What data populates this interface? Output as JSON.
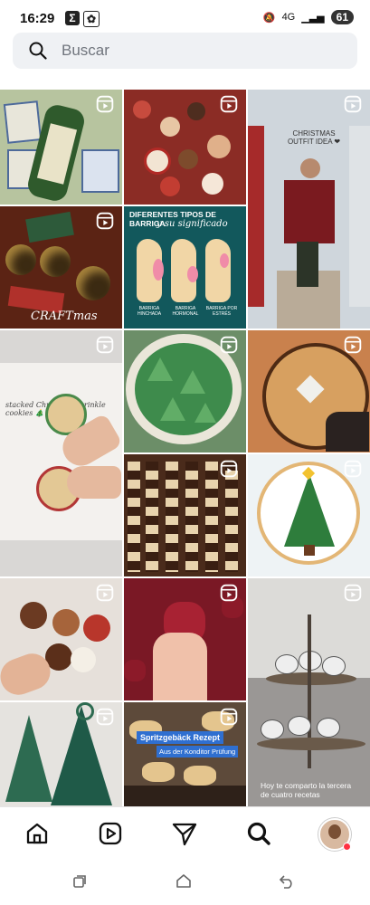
{
  "status_bar": {
    "time": "16:29",
    "signal": "4G",
    "battery": "61"
  },
  "search": {
    "placeholder": "Buscar"
  },
  "tiles": [
    {
      "name": "tiles-bottle",
      "caption": "",
      "bg": "#b7c49f",
      "reel": true
    },
    {
      "name": "cookies-platter",
      "caption": "",
      "bg": "#8b2c25",
      "reel": true
    },
    {
      "name": "christmas-outfit",
      "caption": "CHRISTMAS OUTFIT IDEA ❤",
      "bg": "#cfd6dc",
      "reel": true
    },
    {
      "name": "ornaments",
      "caption": "CRAFTmas",
      "bg": "#5b2314",
      "reel": true
    },
    {
      "name": "barriga",
      "caption": "DIFERENTES TIPOS DE BARRIGA",
      "subcaption": "y su significado",
      "labels": [
        "BARRIGA HINCHADA",
        "BARRIGA HORMONAL",
        "BARRIGA POR ESTRÉS"
      ],
      "bg": "#12585c",
      "reel": false
    },
    {
      "name": "tree-cookies-bowl",
      "caption": "",
      "bg": "#6c8e68",
      "reel": true
    },
    {
      "name": "sprinkle-cookies",
      "caption": "stacked Christmas sprinkle cookies 🎄",
      "bg": "#d9d7d5",
      "reel": true
    },
    {
      "name": "stained-glass-cookie",
      "caption": "",
      "bg": "#c9814d",
      "reel": true
    },
    {
      "name": "chocolate-cookies",
      "caption": "",
      "bg": "#4a2b1b",
      "reel": true
    },
    {
      "name": "tree-cookie",
      "caption": "",
      "bg": "#eef3f5",
      "reel": true
    },
    {
      "name": "cookie-board",
      "caption": "",
      "bg": "#e6e0da",
      "reel": true
    },
    {
      "name": "gummies",
      "caption": "",
      "bg": "#7a1825",
      "reel": true
    },
    {
      "name": "crinkle-cookies",
      "caption": "Hoy te comparto la tercera de cuatro recetas",
      "bg": "#9a9795",
      "reel": true
    },
    {
      "name": "fabric-trees",
      "caption": "",
      "bg": "#e5e3df",
      "reel": true
    },
    {
      "name": "spritzgeback",
      "caption": "Spritzgebäck Rezept",
      "subcaption": "Aus der Konditor Prüfung",
      "bg": "#5d4a3a",
      "reel": true
    }
  ],
  "nav": {
    "items": [
      "home",
      "reels",
      "send",
      "search",
      "profile"
    ]
  },
  "colors": {
    "accent": "#ff3040",
    "search_bg": "#eff1f4"
  }
}
